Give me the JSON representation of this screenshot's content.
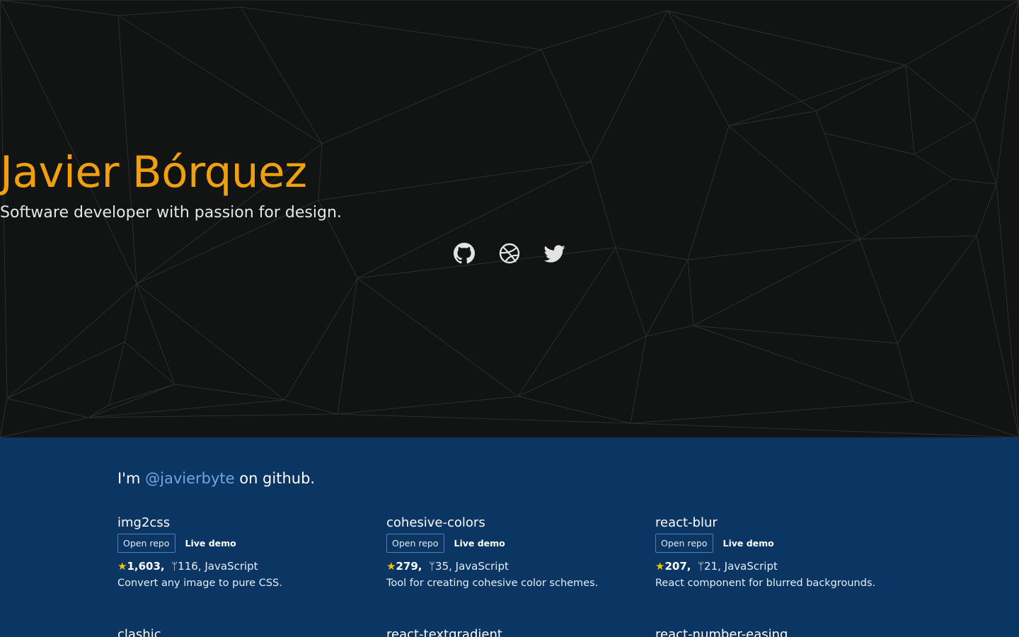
{
  "hero": {
    "title": "Javier Bórquez",
    "subtitle": "Software developer with passion for design.",
    "social": [
      {
        "icon": "github-icon"
      },
      {
        "icon": "dribbble-icon"
      },
      {
        "icon": "twitter-icon"
      }
    ],
    "colors": {
      "background": "#121414",
      "title": "#f0a00e",
      "mesh": "#2b2f2e"
    }
  },
  "intro": {
    "prefix": "I'm ",
    "handle": "@javierbyte",
    "suffix": " on github."
  },
  "repos": [
    {
      "name": "img2css",
      "open_label": "Open repo",
      "demo_label": "Live demo",
      "stars": "1,603,",
      "forks": "116,",
      "language": "JavaScript",
      "description": "Convert any image to pure CSS."
    },
    {
      "name": "cohesive-colors",
      "open_label": "Open repo",
      "demo_label": "Live demo",
      "stars": "279,",
      "forks": "35,",
      "language": "JavaScript",
      "description": "Tool for creating cohesive color schemes."
    },
    {
      "name": "react-blur",
      "open_label": "Open repo",
      "demo_label": "Live demo",
      "stars": "207,",
      "forks": "21,",
      "language": "JavaScript",
      "description": "React component for blurred backgrounds."
    }
  ],
  "repos_row2": [
    {
      "name": "clashic"
    },
    {
      "name": "react-textgradient"
    },
    {
      "name": "react-number-easing"
    }
  ],
  "colors": {
    "section_background": "#0b3563",
    "link": "#6fa6e6",
    "star": "#f4c20d"
  }
}
